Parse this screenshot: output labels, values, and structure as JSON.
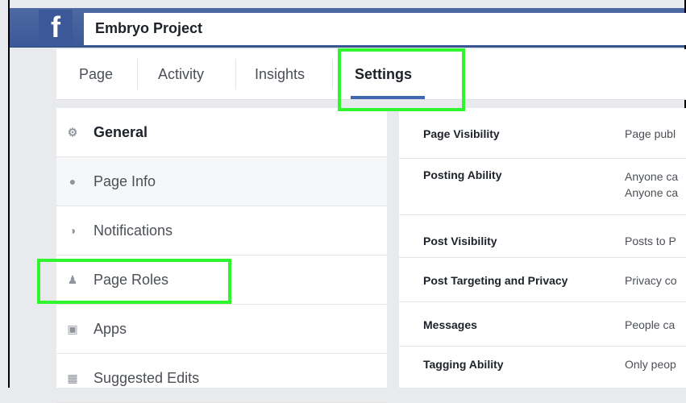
{
  "page": {
    "name": "Embryo Project",
    "logo": "f"
  },
  "tabs": [
    {
      "label": "Page"
    },
    {
      "label": "Activity"
    },
    {
      "label": "Insights"
    },
    {
      "label": "Settings"
    }
  ],
  "menu": [
    {
      "label": "General",
      "icon": "gear-icon"
    },
    {
      "label": "Page Info",
      "icon": "info-icon"
    },
    {
      "label": "Notifications",
      "icon": "globe-icon"
    },
    {
      "label": "Page Roles",
      "icon": "person-icon"
    },
    {
      "label": "Apps",
      "icon": "cube-icon"
    },
    {
      "label": "Suggested Edits",
      "icon": "calendar-icon"
    }
  ],
  "settings_rows": [
    {
      "label": "Page Visibility",
      "value": "Page publ"
    },
    {
      "label": "Posting Ability",
      "value": "Anyone ca",
      "value2": "Anyone ca"
    },
    {
      "label": "Post Visibility",
      "value": "Posts to P"
    },
    {
      "label": "Post Targeting and Privacy",
      "value": "Privacy co"
    },
    {
      "label": "Messages",
      "value": "People ca"
    },
    {
      "label": "Tagging Ability",
      "value": "Only peop"
    }
  ],
  "colors": {
    "brand": "#3b5998",
    "highlight": "#2ef52e",
    "tab_underline": "#4267b2"
  }
}
